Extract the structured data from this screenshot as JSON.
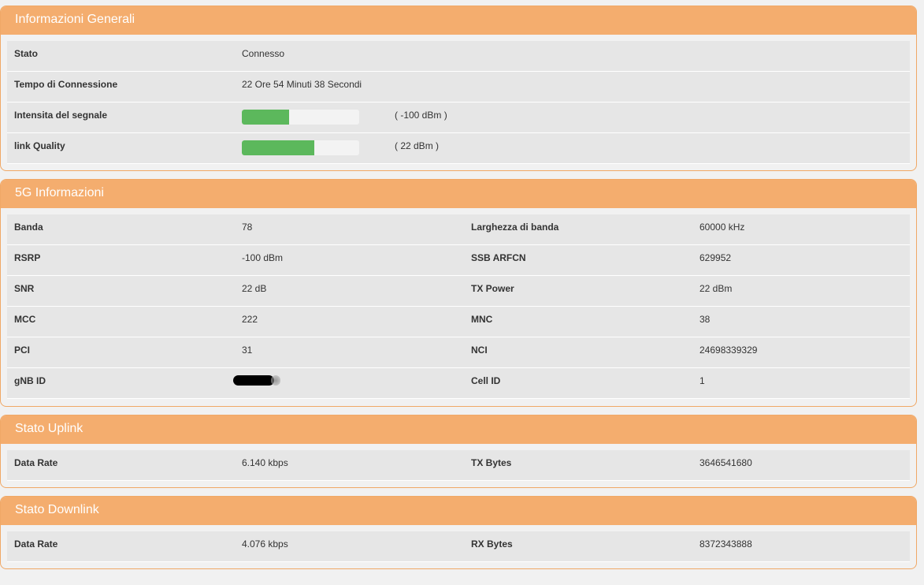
{
  "general": {
    "title": "Informazioni Generali",
    "stato_label": "Stato",
    "stato_value": "Connesso",
    "tempo_label": "Tempo di Connessione",
    "tempo_value": "22 Ore 54 Minuti 38 Secondi",
    "signal_label": "Intensita del segnale",
    "signal_text": "( -100 dBm )",
    "signal_percent": 40,
    "link_label": "link Quality",
    "link_text": "( 22 dBm )",
    "link_percent": 62
  },
  "fiveg": {
    "title": "5G Informazioni",
    "rows": [
      [
        "Banda",
        "78",
        "Larghezza di banda",
        "60000 kHz"
      ],
      [
        "RSRP",
        "-100 dBm",
        "SSB ARFCN",
        "629952"
      ],
      [
        "SNR",
        "22 dB",
        "TX Power",
        "22 dBm"
      ],
      [
        "MCC",
        "222",
        "MNC",
        "38"
      ],
      [
        "PCI",
        "31",
        "NCI",
        "24698339329"
      ],
      [
        "gNB ID",
        null,
        "Cell ID",
        "1"
      ]
    ]
  },
  "uplink": {
    "title": "Stato Uplink",
    "rows": [
      [
        "Data Rate",
        "6.140 kbps",
        "TX Bytes",
        "3646541680"
      ]
    ]
  },
  "downlink": {
    "title": "Stato Downlink",
    "rows": [
      [
        "Data Rate",
        "4.076 kbps",
        "RX Bytes",
        "8372343888"
      ]
    ]
  },
  "colors": {
    "header": "#f4ad6e",
    "bar": "#5cb85c"
  }
}
